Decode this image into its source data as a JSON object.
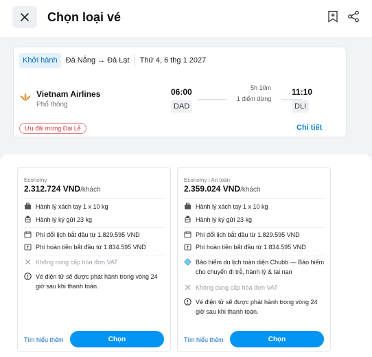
{
  "header": {
    "title": "Chọn loại vé",
    "close_icon": "close-icon",
    "bookmark_icon": "bookmark-add-icon",
    "share_icon": "share-icon"
  },
  "flight": {
    "direction_label": "Khởi hành",
    "route": "Đà Nẵng → Đà Lạt",
    "date": "Thứ 4, 6 thg 1 2027",
    "airline_name": "Vietnam Airlines",
    "cabin_class": "Phổ thông",
    "depart_time": "06:00",
    "depart_code": "DAD",
    "arrive_time": "11:10",
    "arrive_code": "DLI",
    "duration": "5h 10m",
    "stops": "1 điểm dừng",
    "promo": "Ưu đãi mừng Đại Lễ",
    "detail_link": "Chi tiết"
  },
  "fares": [
    {
      "label": "Economy",
      "price": "2.312.724 VND",
      "price_unit": "/khách",
      "features": [
        {
          "icon": "cabin-bag-icon",
          "text": "Hành lý xách tay 1 x 10 kg"
        },
        {
          "icon": "checked-bag-icon",
          "text": "Hành lý ký gửi 23 kg"
        },
        {
          "icon": "calendar-change-icon",
          "text": "Phí đổi lịch bắt đầu từ 1.829.595 VND"
        },
        {
          "icon": "refund-icon",
          "text": "Phí hoàn tiền bắt đầu từ 1.834.595 VND"
        },
        {
          "icon": "x-icon",
          "text": "Không cung cấp hóa đơn VAT"
        },
        {
          "icon": "info-icon",
          "text": "Vé điện tử sẽ được phát hành trong vòng 24 giờ sau khi thanh toán."
        }
      ],
      "learn_more": "Tìm hiểu thêm",
      "select": "Chọn"
    },
    {
      "label": "Economy | An toàn",
      "price": "2.359.024 VND",
      "price_unit": "/khách",
      "features": [
        {
          "icon": "cabin-bag-icon",
          "text": "Hành lý xách tay 1 x 10 kg"
        },
        {
          "icon": "checked-bag-icon",
          "text": "Hành lý ký gửi 23 kg"
        },
        {
          "icon": "calendar-change-icon",
          "text": "Phí đổi lịch bắt đầu từ 1.829.595 VND"
        },
        {
          "icon": "refund-icon",
          "text": "Phí hoàn tiền bắt đầu từ 1.834.595 VND"
        },
        {
          "icon": "insurance-icon",
          "text": "Bảo hiểm du lịch toàn diện Chubb — Bảo hiểm cho chuyến đi trễ, hành lý & tai nạn"
        },
        {
          "icon": "x-icon",
          "text": "Không cung cấp hóa đơn VAT"
        },
        {
          "icon": "info-icon",
          "text": "Vé điện tử sẽ được phát hành trong vòng 24 giờ sau khi thanh toán."
        }
      ],
      "learn_more": "Tìm hiểu thêm",
      "select": "Chọn"
    }
  ],
  "colors": {
    "primary": "#0194f3",
    "link": "#0a6fc2",
    "promo": "#d43c3c"
  }
}
